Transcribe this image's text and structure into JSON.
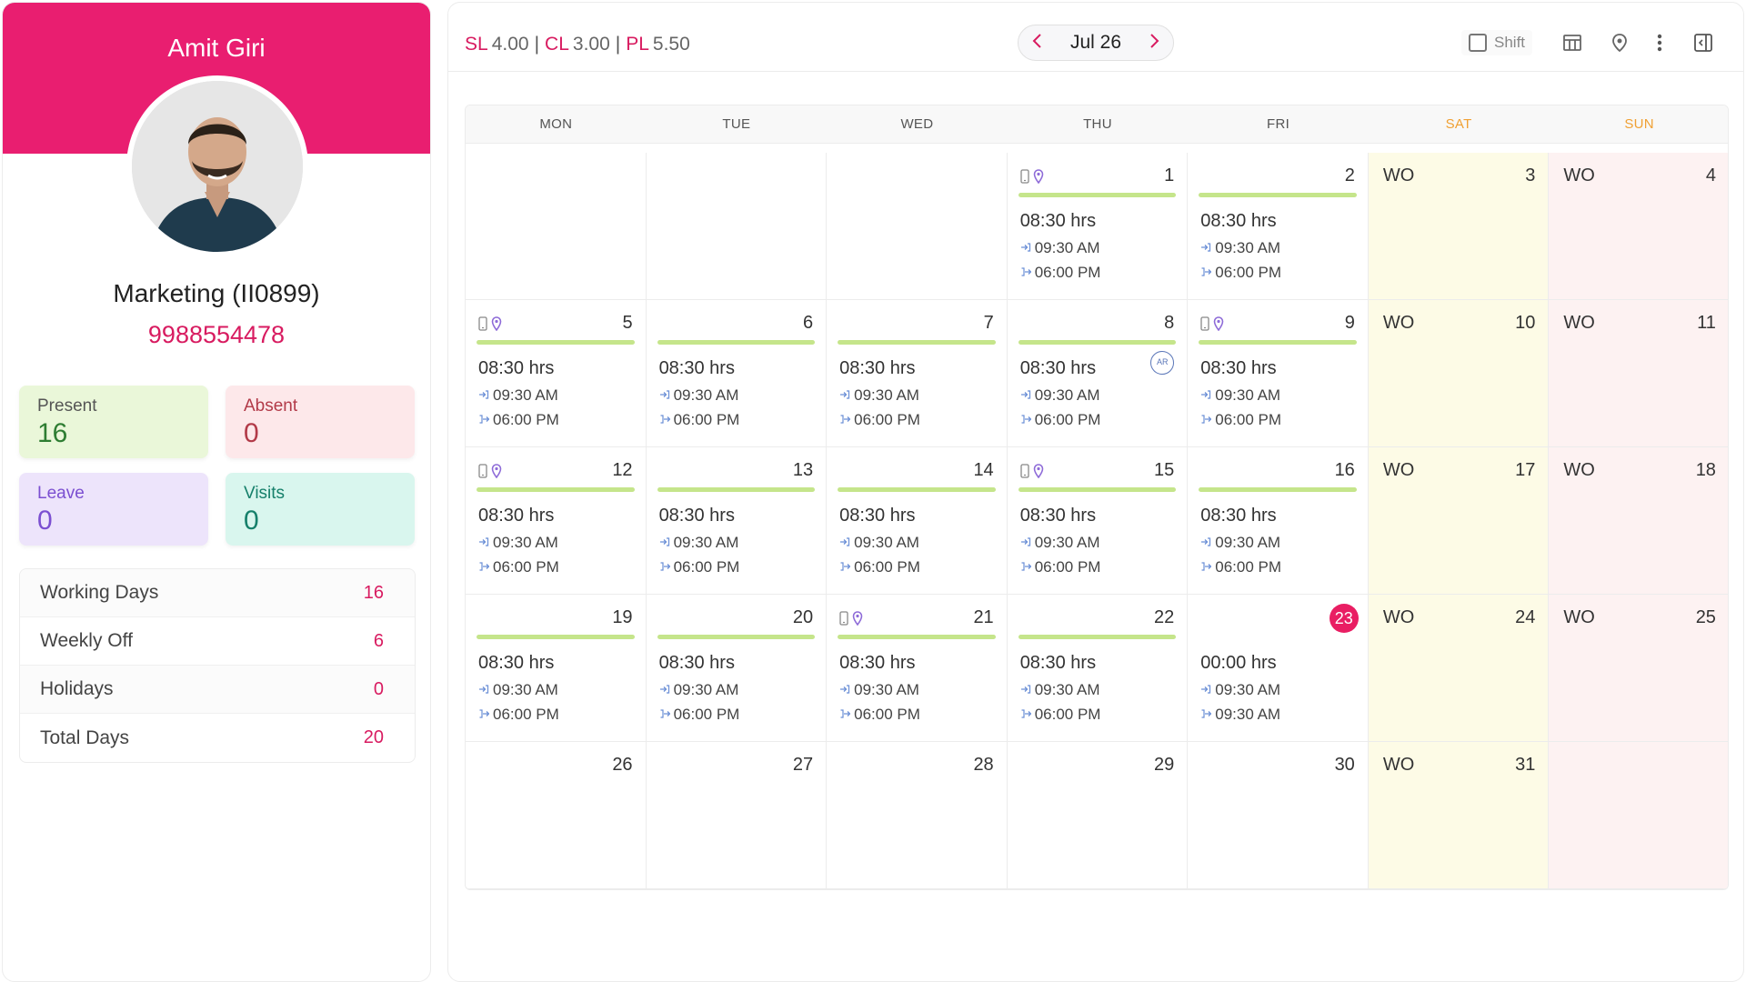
{
  "profile": {
    "name": "Amit Giri",
    "department": "Marketing (II0899)",
    "phone": "9988554478"
  },
  "stats": {
    "present_label": "Present",
    "present_value": "16",
    "absent_label": "Absent",
    "absent_value": "0",
    "leave_label": "Leave",
    "leave_value": "0",
    "visits_label": "Visits",
    "visits_value": "0"
  },
  "summary": [
    {
      "label": "Working Days",
      "value": "16"
    },
    {
      "label": "Weekly Off",
      "value": "6"
    },
    {
      "label": "Holidays",
      "value": "0"
    },
    {
      "label": "Total Days",
      "value": "20"
    }
  ],
  "balances": [
    {
      "key": "SL",
      "value": "4.00"
    },
    {
      "key": "CL",
      "value": "3.00"
    },
    {
      "key": "PL",
      "value": "5.50"
    }
  ],
  "toolbar": {
    "month": "Jul 26",
    "shift_label": "Shift"
  },
  "days": [
    "MON",
    "TUE",
    "WED",
    "THU",
    "FRI",
    "SAT",
    "SUN"
  ],
  "colors": {
    "brand": "#e91e70",
    "progress": "#c5e58b",
    "weekend_header": "#f0a033"
  },
  "calendar": {
    "wo_label": "WO",
    "cells": [
      {
        "empty": true
      },
      {
        "empty": true
      },
      {
        "empty": true
      },
      {
        "day": "1",
        "icons": true,
        "hrs": "08:30 hrs",
        "in": "09:30 AM",
        "out": "06:00 PM"
      },
      {
        "day": "2",
        "hrs": "08:30 hrs",
        "in": "09:30 AM",
        "out": "06:00 PM"
      },
      {
        "day": "3",
        "wo": true
      },
      {
        "day": "4",
        "wo": true
      },
      {
        "day": "5",
        "icons": true,
        "hrs": "08:30 hrs",
        "in": "09:30 AM",
        "out": "06:00 PM"
      },
      {
        "day": "6",
        "hrs": "08:30 hrs",
        "in": "09:30 AM",
        "out": "06:00 PM"
      },
      {
        "day": "7",
        "hrs": "08:30 hrs",
        "in": "09:30 AM",
        "out": "06:00 PM"
      },
      {
        "day": "8",
        "ar": "AR",
        "hrs": "08:30 hrs",
        "in": "09:30 AM",
        "out": "06:00 PM"
      },
      {
        "day": "9",
        "icons": true,
        "hrs": "08:30 hrs",
        "in": "09:30 AM",
        "out": "06:00 PM"
      },
      {
        "day": "10",
        "wo": true
      },
      {
        "day": "11",
        "wo": true
      },
      {
        "day": "12",
        "icons": true,
        "hrs": "08:30 hrs",
        "in": "09:30 AM",
        "out": "06:00 PM"
      },
      {
        "day": "13",
        "hrs": "08:30 hrs",
        "in": "09:30 AM",
        "out": "06:00 PM"
      },
      {
        "day": "14",
        "hrs": "08:30 hrs",
        "in": "09:30 AM",
        "out": "06:00 PM"
      },
      {
        "day": "15",
        "icons": true,
        "hrs": "08:30 hrs",
        "in": "09:30 AM",
        "out": "06:00 PM"
      },
      {
        "day": "16",
        "hrs": "08:30 hrs",
        "in": "09:30 AM",
        "out": "06:00 PM"
      },
      {
        "day": "17",
        "wo": true
      },
      {
        "day": "18",
        "wo": true
      },
      {
        "day": "19",
        "hrs": "08:30 hrs",
        "in": "09:30 AM",
        "out": "06:00 PM"
      },
      {
        "day": "20",
        "hrs": "08:30 hrs",
        "in": "09:30 AM",
        "out": "06:00 PM"
      },
      {
        "day": "21",
        "icons": true,
        "hrs": "08:30 hrs",
        "in": "09:30 AM",
        "out": "06:00 PM"
      },
      {
        "day": "22",
        "hrs": "08:30 hrs",
        "in": "09:30 AM",
        "out": "06:00 PM"
      },
      {
        "day": "23",
        "today": true,
        "nobar": true,
        "hrs": "00:00 hrs",
        "in": "09:30 AM",
        "out": "09:30 AM"
      },
      {
        "day": "24",
        "wo": true
      },
      {
        "day": "25",
        "wo": true
      },
      {
        "day": "26",
        "blank": true
      },
      {
        "day": "27",
        "blank": true
      },
      {
        "day": "28",
        "blank": true
      },
      {
        "day": "29",
        "blank": true
      },
      {
        "day": "30",
        "blank": true
      },
      {
        "day": "31",
        "wo": true
      },
      {
        "empty": true
      }
    ]
  }
}
